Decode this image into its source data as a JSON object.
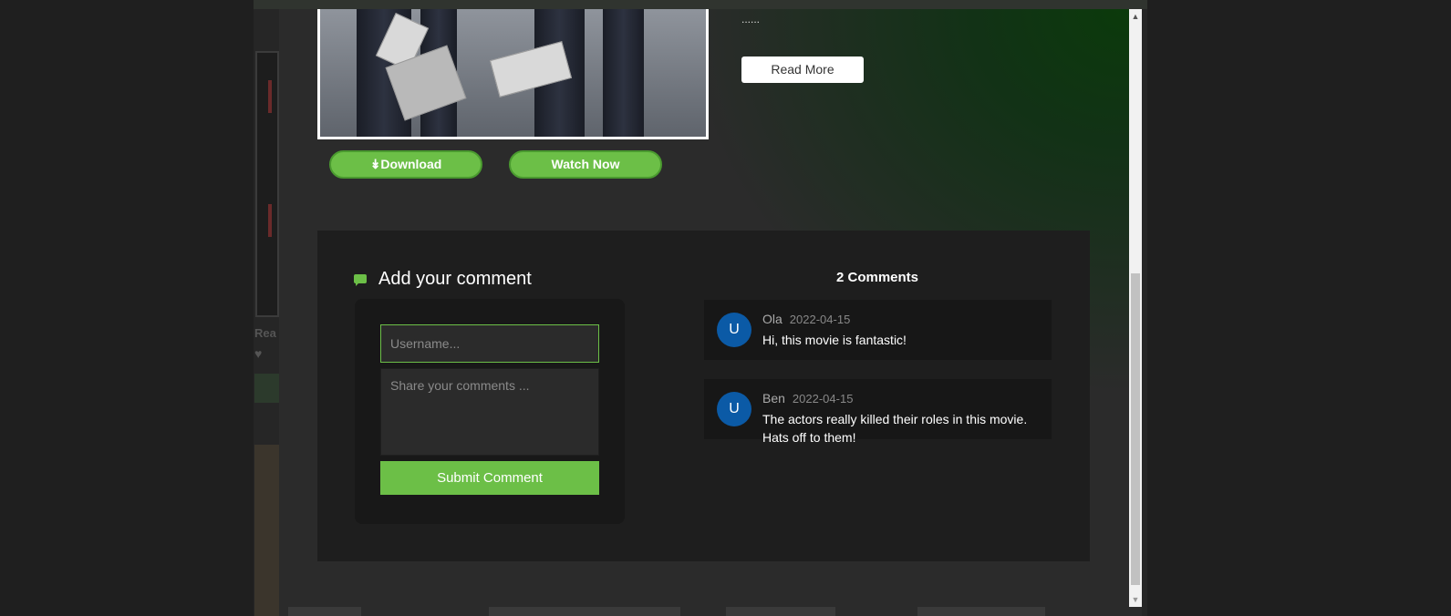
{
  "movie": {
    "download_label": "Download",
    "download_icon": "double-chevron-down-icon",
    "watch_label": "Watch Now",
    "description_excerpt": "......",
    "read_more_label": "Read More"
  },
  "comment_form": {
    "title": "Add your comment",
    "username_placeholder": "Username...",
    "comment_placeholder": "Share your comments ...",
    "submit_label": "Submit Comment"
  },
  "comments": {
    "count_label": "2 Comments",
    "items": [
      {
        "avatar": "U",
        "author": "Ola",
        "date": "2022-04-15",
        "text": "Hi, this movie is fantastic!"
      },
      {
        "avatar": "U",
        "author": "Ben",
        "date": "2022-04-15",
        "text": "The actors really killed their roles in this movie. Hats off to them!"
      }
    ]
  },
  "colors": {
    "accent_green": "#6cbf47",
    "avatar_blue": "#0b5aa6",
    "panel_dark": "#1e1e1e"
  }
}
